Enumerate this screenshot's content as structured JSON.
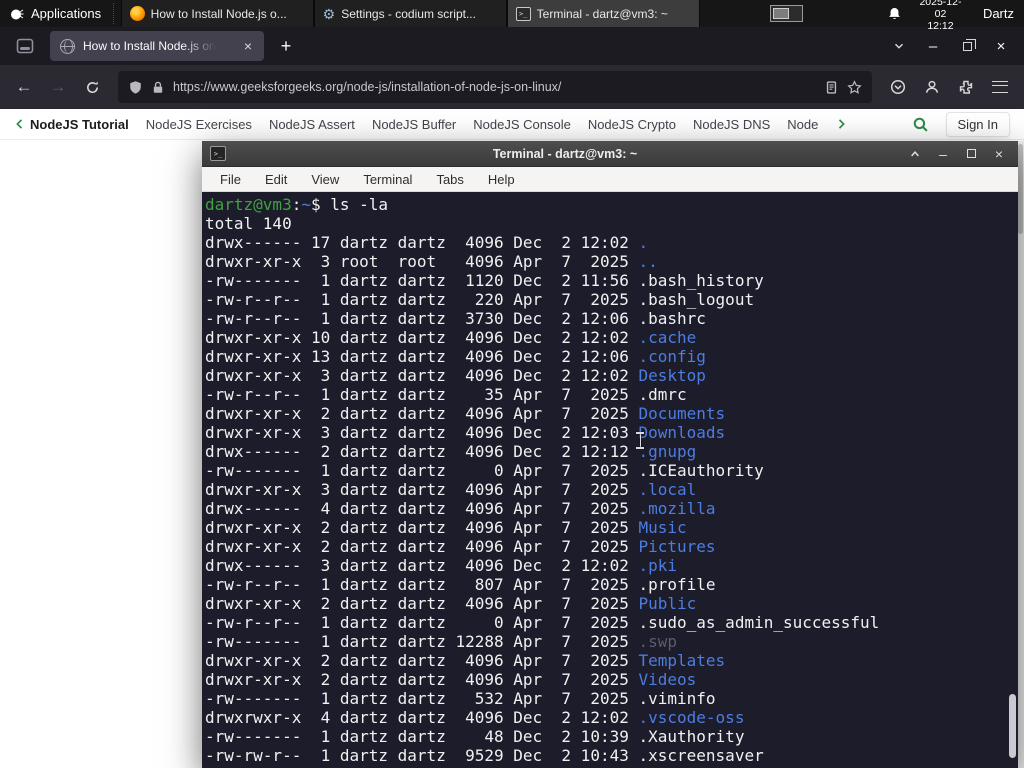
{
  "taskbar": {
    "applications_label": "Applications",
    "windows": [
      {
        "label": "How to Install Node.js o...",
        "icon": "firefox",
        "active": false
      },
      {
        "label": "Settings - codium script...",
        "icon": "settings",
        "active": false
      },
      {
        "label": "Terminal - dartz@vm3: ~",
        "icon": "terminal",
        "active": true
      }
    ],
    "clock_date": "2025-12-02",
    "clock_time": "12:12",
    "user_label": "Dartz"
  },
  "browser": {
    "tab_title": "How to Install Node.js on",
    "url": "https://www.geeksforgeeks.org/node-js/installation-of-node-js-on-linux/"
  },
  "site_nav": {
    "back_label": "NodeJS Tutorial",
    "items": [
      "NodeJS Exercises",
      "NodeJS Assert",
      "NodeJS Buffer",
      "NodeJS Console",
      "NodeJS Crypto",
      "NodeJS DNS",
      "Node"
    ],
    "sign_in_label": "Sign In"
  },
  "terminal": {
    "title": "Terminal - dartz@vm3: ~",
    "menu": [
      "File",
      "Edit",
      "View",
      "Terminal",
      "Tabs",
      "Help"
    ],
    "prompt_user_host": "dartz@vm3",
    "prompt_separator": ":",
    "prompt_path": "~",
    "prompt_symbol": "$ ",
    "command": "ls -la",
    "total_line": "total 140",
    "lines": [
      {
        "pre": "drwx------ 17 dartz dartz  4096 Dec  2 12:02 ",
        "name": ".",
        "type": "dir"
      },
      {
        "pre": "drwxr-xr-x  3 root  root   4096 Apr  7  2025 ",
        "name": "..",
        "type": "dir"
      },
      {
        "pre": "-rw-------  1 dartz dartz  1120 Dec  2 11:56 ",
        "name": ".bash_history",
        "type": "file"
      },
      {
        "pre": "-rw-r--r--  1 dartz dartz   220 Apr  7  2025 ",
        "name": ".bash_logout",
        "type": "file"
      },
      {
        "pre": "-rw-r--r--  1 dartz dartz  3730 Dec  2 12:06 ",
        "name": ".bashrc",
        "type": "file"
      },
      {
        "pre": "drwxr-xr-x 10 dartz dartz  4096 Dec  2 12:02 ",
        "name": ".cache",
        "type": "dir"
      },
      {
        "pre": "drwxr-xr-x 13 dartz dartz  4096 Dec  2 12:06 ",
        "name": ".config",
        "type": "dir"
      },
      {
        "pre": "drwxr-xr-x  3 dartz dartz  4096 Dec  2 12:02 ",
        "name": "Desktop",
        "type": "dir"
      },
      {
        "pre": "-rw-r--r--  1 dartz dartz    35 Apr  7  2025 ",
        "name": ".dmrc",
        "type": "file"
      },
      {
        "pre": "drwxr-xr-x  2 dartz dartz  4096 Apr  7  2025 ",
        "name": "Documents",
        "type": "dir"
      },
      {
        "pre": "drwxr-xr-x  3 dartz dartz  4096 Dec  2 12:03 ",
        "name": "Downloads",
        "type": "dir"
      },
      {
        "pre": "drwx------  2 dartz dartz  4096 Dec  2 12:12 ",
        "name": ".gnupg",
        "type": "dir"
      },
      {
        "pre": "-rw-------  1 dartz dartz     0 Apr  7  2025 ",
        "name": ".ICEauthority",
        "type": "file"
      },
      {
        "pre": "drwxr-xr-x  3 dartz dartz  4096 Apr  7  2025 ",
        "name": ".local",
        "type": "dir"
      },
      {
        "pre": "drwx------  4 dartz dartz  4096 Apr  7  2025 ",
        "name": ".mozilla",
        "type": "dir"
      },
      {
        "pre": "drwxr-xr-x  2 dartz dartz  4096 Apr  7  2025 ",
        "name": "Music",
        "type": "dir"
      },
      {
        "pre": "drwxr-xr-x  2 dartz dartz  4096 Apr  7  2025 ",
        "name": "Pictures",
        "type": "dir"
      },
      {
        "pre": "drwx------  3 dartz dartz  4096 Dec  2 12:02 ",
        "name": ".pki",
        "type": "dir"
      },
      {
        "pre": "-rw-r--r--  1 dartz dartz   807 Apr  7  2025 ",
        "name": ".profile",
        "type": "file"
      },
      {
        "pre": "drwxr-xr-x  2 dartz dartz  4096 Apr  7  2025 ",
        "name": "Public",
        "type": "dir"
      },
      {
        "pre": "-rw-r--r--  1 dartz dartz     0 Apr  7  2025 ",
        "name": ".sudo_as_admin_successful",
        "type": "file"
      },
      {
        "pre": "-rw-------  1 dartz dartz 12288 Apr  7  2025 ",
        "name": ".swp",
        "type": "dim"
      },
      {
        "pre": "drwxr-xr-x  2 dartz dartz  4096 Apr  7  2025 ",
        "name": "Templates",
        "type": "dir"
      },
      {
        "pre": "drwxr-xr-x  2 dartz dartz  4096 Apr  7  2025 ",
        "name": "Videos",
        "type": "dir"
      },
      {
        "pre": "-rw-------  1 dartz dartz   532 Apr  7  2025 ",
        "name": ".viminfo",
        "type": "file"
      },
      {
        "pre": "drwxrwxr-x  4 dartz dartz  4096 Dec  2 12:02 ",
        "name": ".vscode-oss",
        "type": "dir"
      },
      {
        "pre": "-rw-------  1 dartz dartz    48 Dec  2 10:39 ",
        "name": ".Xauthority",
        "type": "file"
      },
      {
        "pre": "-rw-rw-r--  1 dartz dartz  9529 Dec  2 10:43 ",
        "name": ".xscreensaver",
        "type": "file"
      }
    ]
  },
  "glyphs": {
    "plus": "+",
    "close": "×",
    "minimize": "–",
    "gear": "⚙",
    "terminal_prompt": ">_",
    "back_arrow": "←",
    "forward_arrow": "→"
  },
  "colors": {
    "dir": "#4d7de0",
    "file": "#f1f1f1",
    "dim": "#5c5c6e",
    "prompt_green": "#3fa33f",
    "accent_green": "#2f8d46"
  }
}
